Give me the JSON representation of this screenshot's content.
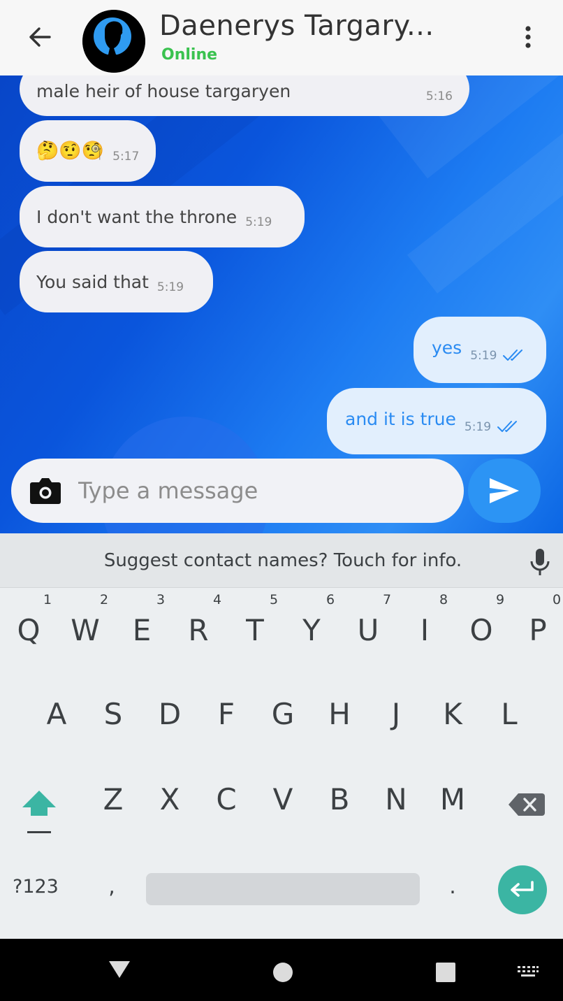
{
  "header": {
    "contact_name": "Daenerys Targary...",
    "status": "Online",
    "back_icon": "arrow-left-icon",
    "menu_icon": "more-vertical-icon",
    "status_color": "#3ac24f"
  },
  "messages": [
    {
      "direction": "incoming",
      "text": "male heir of house targaryen",
      "time": "5:16"
    },
    {
      "direction": "incoming",
      "text": "🤔🤨🧐",
      "time": "5:17"
    },
    {
      "direction": "incoming",
      "text": "I don't want the throne",
      "time": "5:19"
    },
    {
      "direction": "incoming",
      "text": "You said that",
      "time": "5:19"
    },
    {
      "direction": "outgoing",
      "text": "yes",
      "time": "5:19",
      "status_icon": "double-check-icon"
    },
    {
      "direction": "outgoing",
      "text": "and it is true",
      "time": "5:19",
      "status_icon": "double-check-icon"
    }
  ],
  "composer": {
    "placeholder": "Type a message",
    "value": "",
    "camera_icon": "camera-icon",
    "send_icon": "send-icon",
    "accent_color": "#2c94f4"
  },
  "keyboard": {
    "suggestion_text": "Suggest contact names? Touch for info.",
    "mic_icon": "microphone-icon",
    "row1": [
      {
        "key": "Q",
        "hint": "1"
      },
      {
        "key": "W",
        "hint": "2"
      },
      {
        "key": "E",
        "hint": "3"
      },
      {
        "key": "R",
        "hint": "4"
      },
      {
        "key": "T",
        "hint": "5"
      },
      {
        "key": "Y",
        "hint": "6"
      },
      {
        "key": "U",
        "hint": "7"
      },
      {
        "key": "I",
        "hint": "8"
      },
      {
        "key": "O",
        "hint": "9"
      },
      {
        "key": "P",
        "hint": "0"
      }
    ],
    "row2": [
      "A",
      "S",
      "D",
      "F",
      "G",
      "H",
      "J",
      "K",
      "L"
    ],
    "row3": [
      "Z",
      "X",
      "C",
      "V",
      "B",
      "N",
      "M"
    ],
    "shift_icon": "shift-icon",
    "backspace_icon": "backspace-icon",
    "symbols_label": "?123",
    "comma_label": ",",
    "period_label": ".",
    "enter_icon": "enter-icon",
    "enter_color": "#3bb5a3"
  },
  "navbar": {
    "back_icon": "nav-back-icon",
    "home_icon": "nav-home-icon",
    "recents_icon": "nav-recents-icon",
    "keyboard_icon": "keyboard-switch-icon"
  }
}
